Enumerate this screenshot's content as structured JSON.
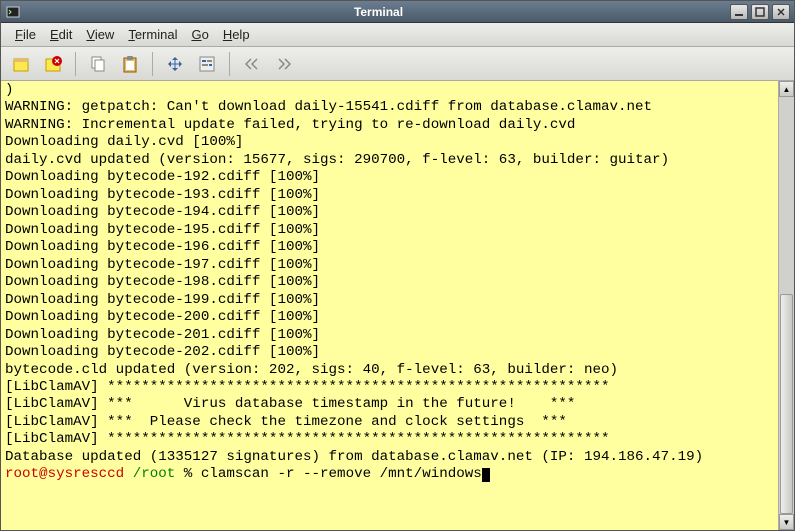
{
  "window": {
    "title": "Terminal"
  },
  "menus": {
    "file": "File",
    "edit": "Edit",
    "view": "View",
    "terminal": "Terminal",
    "go": "Go",
    "help": "Help"
  },
  "terminal": {
    "lines": [
      ")",
      "WARNING: getpatch: Can't download daily-15541.cdiff from database.clamav.net",
      "WARNING: Incremental update failed, trying to re-download daily.cvd",
      "Downloading daily.cvd [100%]",
      "daily.cvd updated (version: 15677, sigs: 290700, f-level: 63, builder: guitar)",
      "Downloading bytecode-192.cdiff [100%]",
      "Downloading bytecode-193.cdiff [100%]",
      "Downloading bytecode-194.cdiff [100%]",
      "Downloading bytecode-195.cdiff [100%]",
      "Downloading bytecode-196.cdiff [100%]",
      "Downloading bytecode-197.cdiff [100%]",
      "Downloading bytecode-198.cdiff [100%]",
      "Downloading bytecode-199.cdiff [100%]",
      "Downloading bytecode-200.cdiff [100%]",
      "Downloading bytecode-201.cdiff [100%]",
      "Downloading bytecode-202.cdiff [100%]",
      "bytecode.cld updated (version: 202, sigs: 40, f-level: 63, builder: neo)",
      "[LibClamAV] ***********************************************************",
      "[LibClamAV] ***      Virus database timestamp in the future!    ***",
      "[LibClamAV] ***  Please check the timezone and clock settings  ***",
      "[LibClamAV] ***********************************************************",
      "Database updated (1335127 signatures) from database.clamav.net (IP: 194.186.47.19)"
    ],
    "prompt_user": "root@sysresccd",
    "prompt_path": "/root",
    "prompt_symbol": "%",
    "command": "clamscan -r --remove /mnt/windows"
  }
}
